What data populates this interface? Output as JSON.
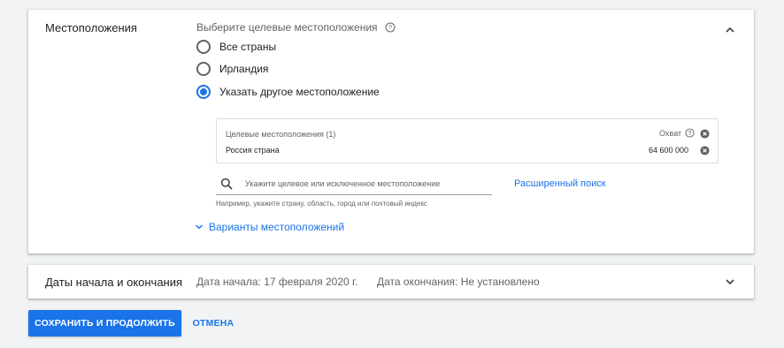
{
  "locations": {
    "title": "Местоположения",
    "subtitle": "Выберите целевые местоположения",
    "options": [
      {
        "label": "Все страны",
        "checked": false
      },
      {
        "label": "Ирландия",
        "checked": false
      },
      {
        "label": "Указать другое местоположение",
        "checked": true
      }
    ],
    "targets": {
      "header": "Целевые местоположения (1)",
      "reach_label": "Охват",
      "row": {
        "name": "Россия страна",
        "reach": "64 600 000"
      }
    },
    "search": {
      "placeholder": "Укажите целевое или исключенное местоположение",
      "hint": "Например, укажите страну, область, город или почтовый индекс",
      "advanced_link": "Расширенный поиск"
    },
    "variants_link": "Варианты местоположений"
  },
  "dates": {
    "title": "Даты начала и окончания",
    "start": "Дата начала: 17 февраля 2020 г.",
    "end": "Дата окончания: Не установлено"
  },
  "actions": {
    "save": "СОХРАНИТЬ И ПРОДОЛЖИТЬ",
    "cancel": "ОТМЕНА"
  },
  "colors": {
    "accent": "#1a73e8",
    "background": "#f1f3f4"
  }
}
